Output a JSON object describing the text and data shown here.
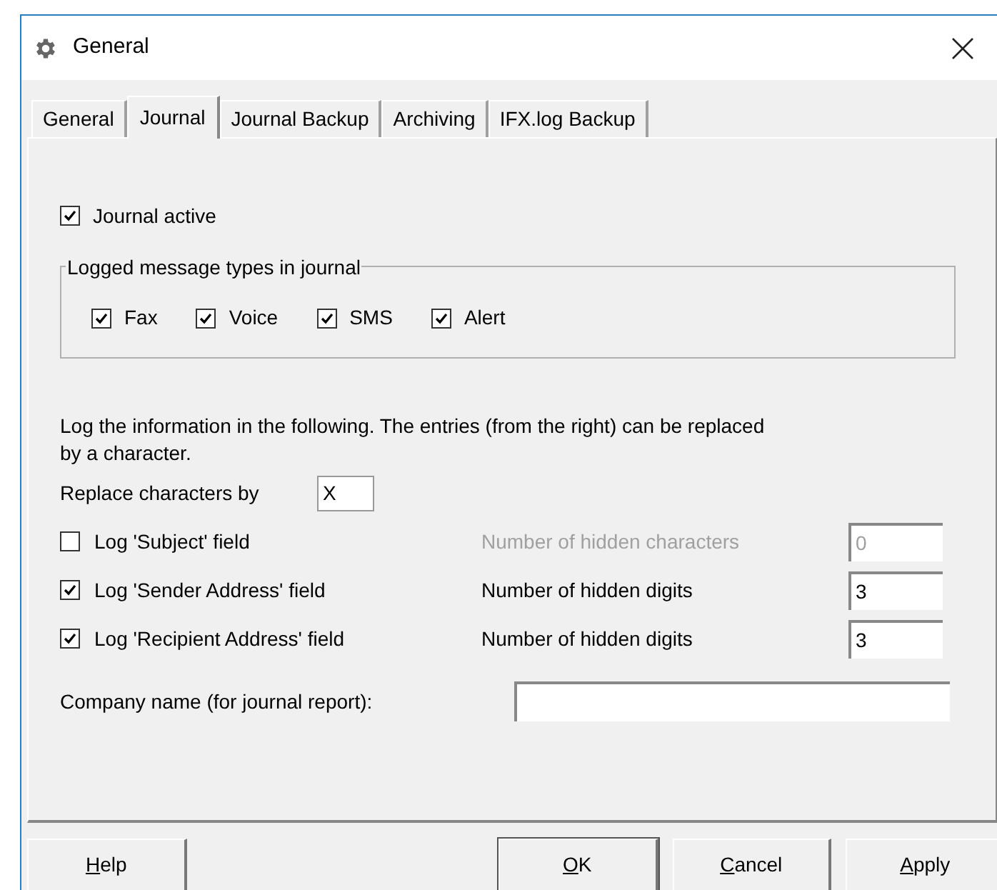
{
  "window": {
    "title": "General"
  },
  "tabs": [
    {
      "label": "General",
      "selected": false
    },
    {
      "label": "Journal",
      "selected": true
    },
    {
      "label": "Journal Backup",
      "selected": false
    },
    {
      "label": "Archiving",
      "selected": false
    },
    {
      "label": "IFX.log Backup",
      "selected": false
    }
  ],
  "journal_active": {
    "label": "Journal active",
    "checked": true
  },
  "message_types": {
    "title": "Logged message types in journal",
    "items": [
      {
        "label": "Fax",
        "checked": true
      },
      {
        "label": "Voice",
        "checked": true
      },
      {
        "label": "SMS",
        "checked": true
      },
      {
        "label": "Alert",
        "checked": true
      }
    ]
  },
  "info_text": "Log the information in the following. The entries (from the right) can be replaced by a character.",
  "replace": {
    "label": "Replace characters by",
    "value": "X"
  },
  "log_fields": [
    {
      "label": "Log 'Subject' field",
      "checked": false,
      "count_label": "Number of hidden characters",
      "value": "0",
      "disabled": true
    },
    {
      "label": "Log 'Sender Address' field",
      "checked": true,
      "count_label": "Number of hidden digits",
      "value": "3",
      "disabled": false
    },
    {
      "label": "Log 'Recipient Address' field",
      "checked": true,
      "count_label": "Number of hidden digits",
      "value": "3",
      "disabled": false
    }
  ],
  "company": {
    "label": "Company name (for journal report):"
  },
  "buttons": [
    {
      "label": "Help",
      "mnemonic": true,
      "default": false
    },
    {
      "label": "OK",
      "mnemonic": true,
      "default": true
    },
    {
      "label": "Cancel",
      "mnemonic": true,
      "default": false
    },
    {
      "label": "Apply",
      "mnemonic": true,
      "default": false
    }
  ]
}
